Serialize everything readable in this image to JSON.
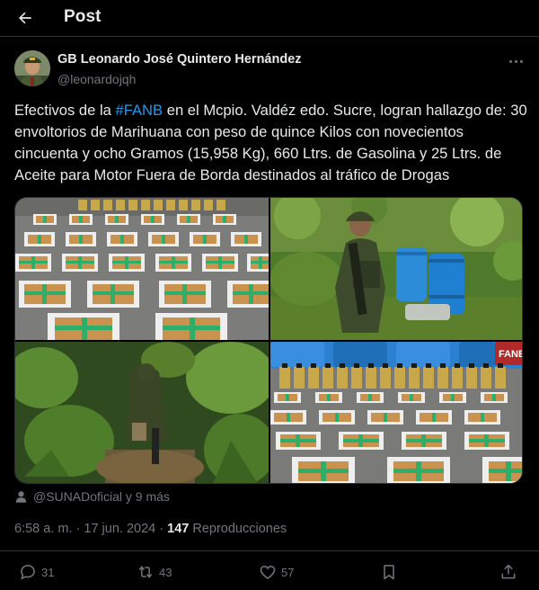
{
  "header": {
    "title": "Post",
    "back_icon": "arrow-left-icon"
  },
  "author": {
    "name": "GB Leonardo José Quintero Hernández",
    "handle": "@leonardojqh"
  },
  "post": {
    "text_before": "Efectivos de la ",
    "hashtag": "#FANB",
    "text_after": " en el Mcpio. Valdéz edo. Sucre, logran hallazgo de: 30 envoltorios de Marihuana con peso de quince Kilos con novecientos cincuenta y ocho Gramos (15,958 Kg), 660 Ltrs. de Gasolina y 25 Ltrs. de Aceite para Motor Fuera de Borda destinados al tráfico de Drogas"
  },
  "media": {
    "photo_1": "packages-on-floor",
    "photo_2": "soldier-with-barrels",
    "photo_3": "soldier-in-vegetation",
    "photo_4": "packages-and-oil-bottles",
    "photo_4_banner": "FANB"
  },
  "tagged": {
    "icon": "person-icon",
    "text": "@SUNADoficial y 9 más"
  },
  "meta": {
    "time": "6:58 a. m.",
    "separator": "·",
    "date": "17 jun. 2024",
    "views_count": "147",
    "views_label": "Reproducciones"
  },
  "actions": {
    "replies": "31",
    "reposts": "43",
    "likes": "57"
  },
  "colors": {
    "background": "#000000",
    "text": "#e7e9ea",
    "muted": "#71767b",
    "link": "#1d9bf0",
    "border": "#2f3336"
  }
}
